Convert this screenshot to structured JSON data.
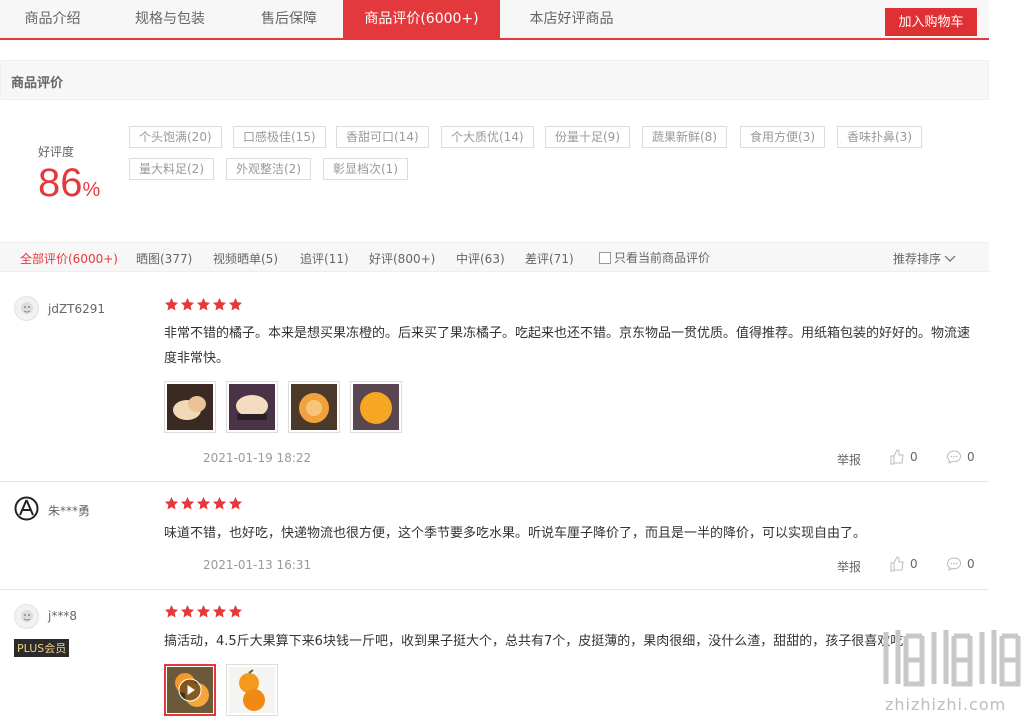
{
  "tabs": [
    {
      "label": "商品介绍",
      "active": false
    },
    {
      "label": "规格与包装",
      "active": false
    },
    {
      "label": "售后保障",
      "active": false
    },
    {
      "label": "商品评价(6000+)",
      "active": true
    },
    {
      "label": "本店好评商品",
      "active": false
    }
  ],
  "cart_button": "加入购物车",
  "section_title": "商品评价",
  "rate": {
    "label": "好评度",
    "value": "86",
    "unit": "%"
  },
  "tags": [
    "个头饱满(20)",
    "口感极佳(15)",
    "香甜可口(14)",
    "个大质优(14)",
    "份量十足(9)",
    "蔬果新鲜(8)",
    "食用方便(3)",
    "香味扑鼻(3)",
    "量大料足(2)",
    "外观整洁(2)",
    "彰显档次(1)"
  ],
  "filters": [
    {
      "label": "全部评价(6000+)",
      "active": true
    },
    {
      "label": "晒图(377)",
      "active": false
    },
    {
      "label": "视频晒单(5)",
      "active": false
    },
    {
      "label": "追评(11)",
      "active": false
    },
    {
      "label": "好评(800+)",
      "active": false
    },
    {
      "label": "中评(63)",
      "active": false
    },
    {
      "label": "差评(71)",
      "active": false
    }
  ],
  "only_current_label": "只看当前商品评价",
  "sort_label": "推荐排序",
  "colors": {
    "accent": "#e4393c",
    "star": "#e4393c"
  },
  "reviews": [
    {
      "user": "jdZT6291",
      "stars": 5,
      "content": "非常不错的橘子。本来是想买果冻橙的。后来买了果冻橘子。吃起来也还不错。京东物品一贯优质。值得推荐。用纸箱包装的好好的。物流速度非常快。",
      "date": "2021-01-19 18:22",
      "report": "举报",
      "likes": "0",
      "comments": "0"
    },
    {
      "user": "朱***勇",
      "stars": 5,
      "content": "味道不错，也好吃，快递物流也很方便，这个季节要多吃水果。听说车厘子降价了，而且是一半的降价，可以实现自由了。",
      "date": "2021-01-13 16:31",
      "report": "举报",
      "likes": "0",
      "comments": "0"
    },
    {
      "user": "j***8",
      "badge": "PLUS会员",
      "stars": 5,
      "content": "搞活动，4.5斤大果算下来6块钱一斤吧，收到果子挺大个，总共有7个，皮挺薄的，果肉很细，没什么渣，甜甜的，孩子很喜欢吃。"
    }
  ],
  "watermark": "zhizhizhi.com"
}
